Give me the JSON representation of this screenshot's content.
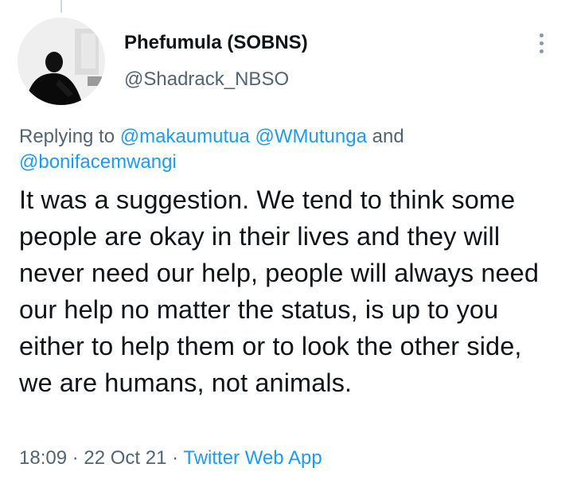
{
  "tweet": {
    "author": {
      "display_name": "Phefumula (SOBNS)",
      "handle": "@Shadrack_NBSO"
    },
    "replying": {
      "prefix": "Replying to ",
      "mentions": [
        "@makaumutua",
        "@WMutunga",
        "@bonifacemwangi"
      ],
      "separator_space": " ",
      "and_text": " and "
    },
    "text": "It was a suggestion. We tend to think some people are okay in their lives and they will never need our help, people will always need our help no matter the status, is up to you either to help them or to look the other side, we are humans, not animals.",
    "time": "18:09",
    "dot": " · ",
    "date": "22 Oct 21",
    "source": "Twitter Web App"
  },
  "icons": {
    "more": "more-options-icon"
  },
  "colors": {
    "text_primary": "#0f1419",
    "text_secondary": "#536471",
    "link": "#1d9bf0"
  }
}
